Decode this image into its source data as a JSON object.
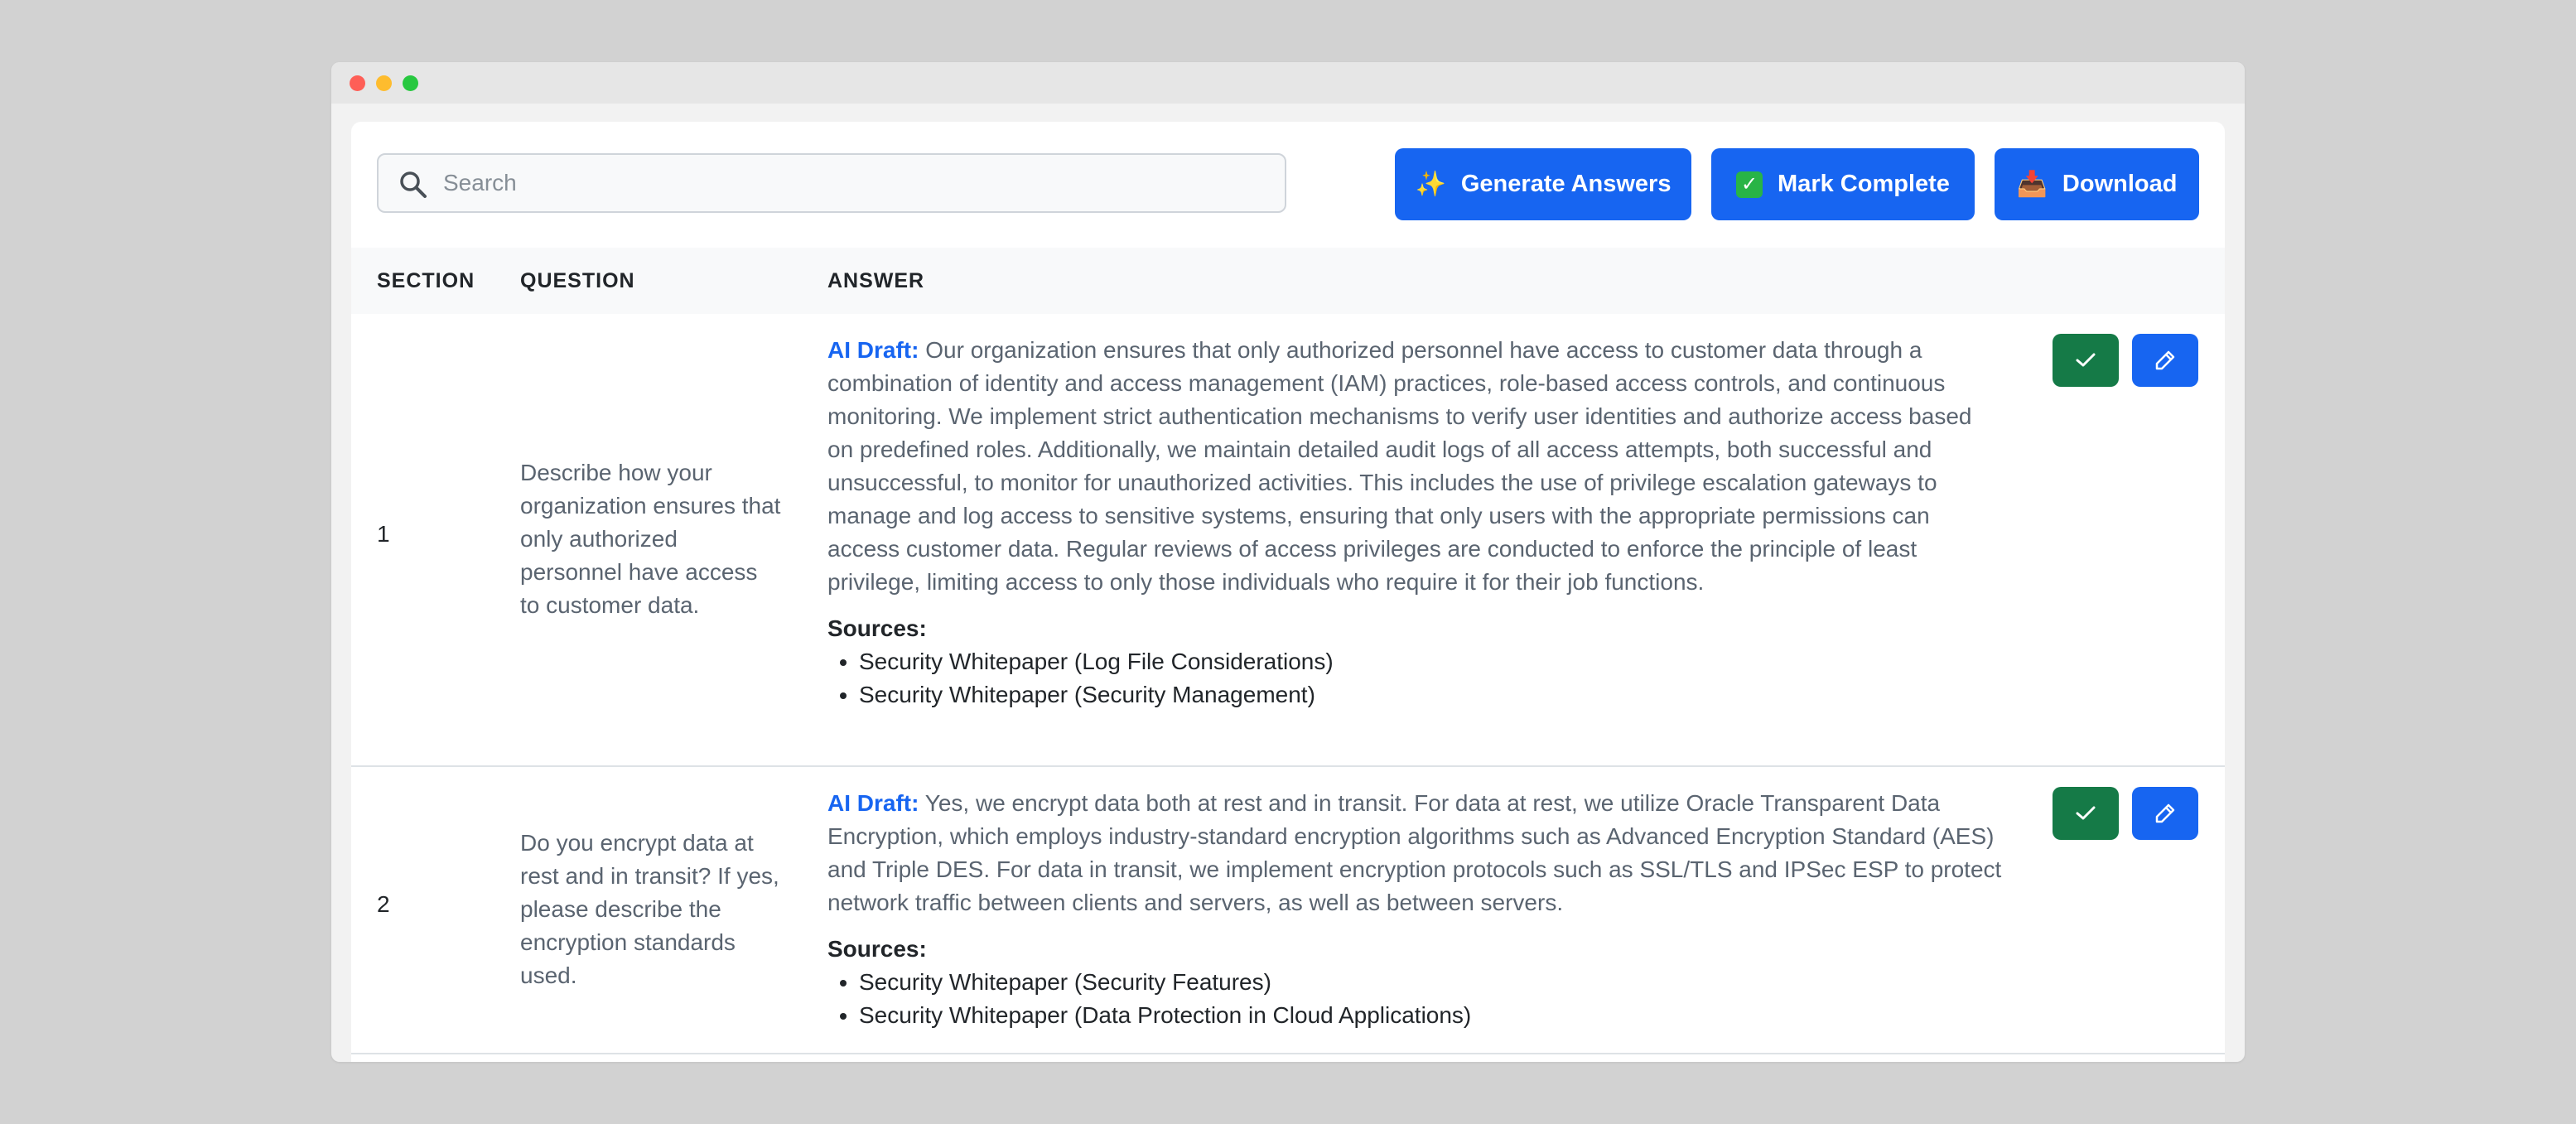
{
  "search": {
    "placeholder": "Search"
  },
  "toolbar": {
    "generate_icon": "✨",
    "generate_label": "Generate Answers",
    "complete_icon": "✓",
    "complete_label": "Mark Complete",
    "download_icon": "📥",
    "download_label": "Download"
  },
  "table": {
    "headers": {
      "section": "SECTION",
      "question": "QUESTION",
      "answer": "ANSWER"
    },
    "rows": [
      {
        "section": "1",
        "question": "Describe how your organization ensures that only authorized personnel have access to customer data.",
        "answer_label": "AI Draft:",
        "answer": "Our organization ensures that only authorized personnel have access to customer data through a combination of identity and access management (IAM) practices, role-based access controls, and continuous monitoring. We implement strict authentication mechanisms to verify user identities and authorize access based on predefined roles. Additionally, we maintain detailed audit logs of all access attempts, both successful and unsuccessful, to monitor for unauthorized activities. This includes the use of privilege escalation gateways to manage and log access to sensitive systems, ensuring that only users with the appropriate permissions can access customer data. Regular reviews of access privileges are conducted to enforce the principle of least privilege, limiting access to only those individuals who require it for their job functions.",
        "sources_title": "Sources:",
        "sources": [
          "Security Whitepaper (Log File Considerations)",
          "Security Whitepaper (Security Management)"
        ]
      },
      {
        "section": "2",
        "question": "Do you encrypt data at rest and in transit? If yes, please describe the encryption standards used.",
        "answer_label": "AI Draft:",
        "answer": "Yes, we encrypt data both at rest and in transit. For data at rest, we utilize Oracle Transparent Data Encryption, which employs industry-standard encryption algorithms such as Advanced Encryption Standard (AES) and Triple DES. For data in transit, we implement encryption protocols such as SSL/TLS and IPSec ESP to protect network traffic between clients and servers, as well as between servers.",
        "sources_title": "Sources:",
        "sources": [
          "Security Whitepaper (Security Features)",
          "Security Whitepaper (Data Protection in Cloud Applications)"
        ]
      }
    ]
  },
  "colors": {
    "primary": "#1765f1",
    "approve": "#157a47",
    "ai_label": "#1765f1"
  }
}
